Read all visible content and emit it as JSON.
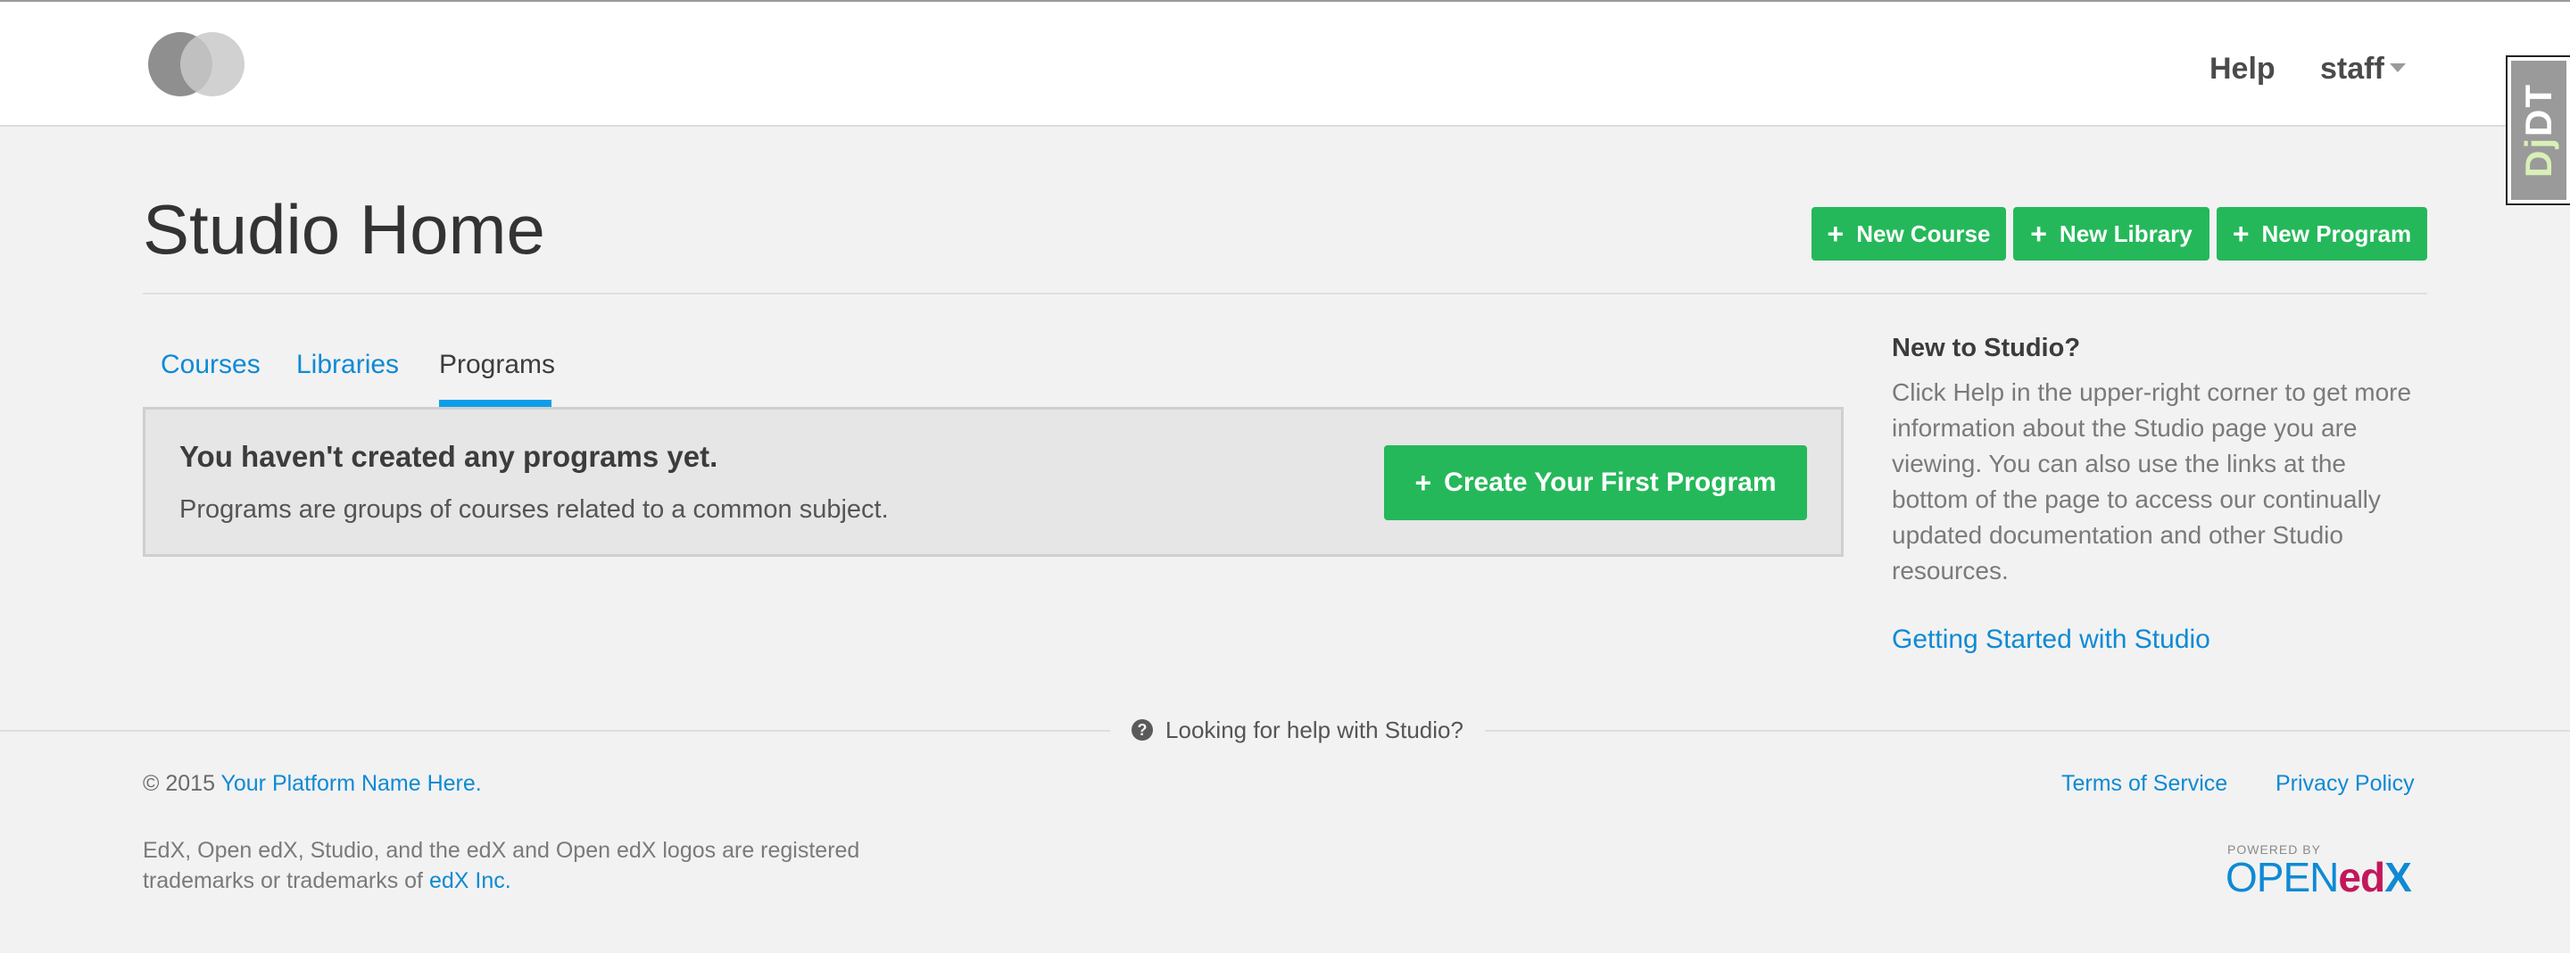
{
  "header": {
    "help_label": "Help",
    "user_label": "staff"
  },
  "debug_toolbar": {
    "label_prefix": "Dj",
    "label_suffix": "DT"
  },
  "page": {
    "title": "Studio Home",
    "actions": [
      {
        "label": "New Course",
        "icon": "plus-icon"
      },
      {
        "label": "New Library",
        "icon": "plus-icon"
      },
      {
        "label": "New Program",
        "icon": "plus-icon"
      }
    ]
  },
  "tabs": [
    {
      "label": "Courses",
      "active": false
    },
    {
      "label": "Libraries",
      "active": false
    },
    {
      "label": "Programs",
      "active": true
    }
  ],
  "notice": {
    "title": "You haven't created any programs yet.",
    "description": "Programs are groups of courses related to a common subject.",
    "button_label": "Create Your First Program"
  },
  "sidebar": {
    "title": "New to Studio?",
    "body": "Click Help in the upper-right corner to get more information about the Studio page you are viewing. You can also use the links at the bottom of the page to access our continually updated documentation and other Studio resources.",
    "link_label": "Getting Started with Studio"
  },
  "footer": {
    "help_text": "Looking for help with Studio?",
    "copyright_prefix": "© 2015",
    "platform_name": "Your Platform Name Here.",
    "terms_label": "Terms of Service",
    "privacy_label": "Privacy Policy",
    "trademark_text": "EdX, Open edX, Studio, and the edX and Open edX logos are registered trademarks or trademarks of",
    "trademark_link": "edX Inc.",
    "powered_by_label": "POWERED BY",
    "powered_logo_open": "OPEN",
    "powered_logo_ed": "ed",
    "powered_logo_x": "X"
  },
  "colors": {
    "accent_green": "#25b85a",
    "link_blue": "#0e8ad4",
    "tab_underline": "#0e9ee8",
    "background": "#f2f2f2"
  }
}
